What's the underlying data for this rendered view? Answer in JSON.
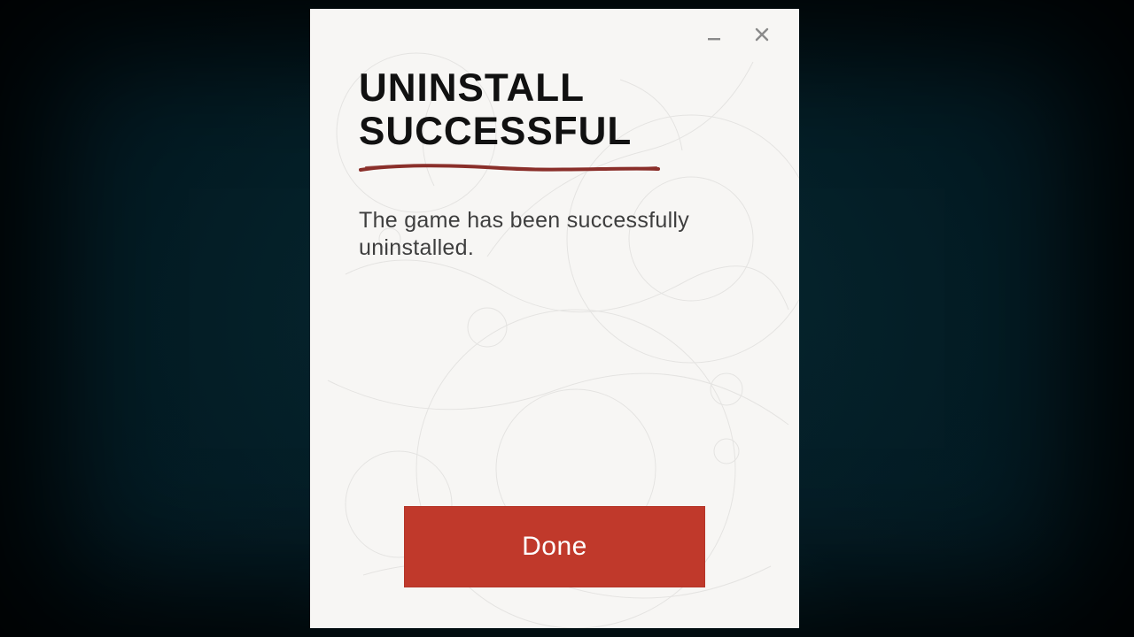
{
  "dialog": {
    "heading": "UNINSTALL\nSUCCESSFUL",
    "body": "The game has been successfully uninstalled.",
    "done_label": "Done",
    "accent_color": "#c0392b",
    "rule_color": "#8a2f2a"
  },
  "window": {
    "minimize_tooltip": "Minimize",
    "close_tooltip": "Close"
  }
}
